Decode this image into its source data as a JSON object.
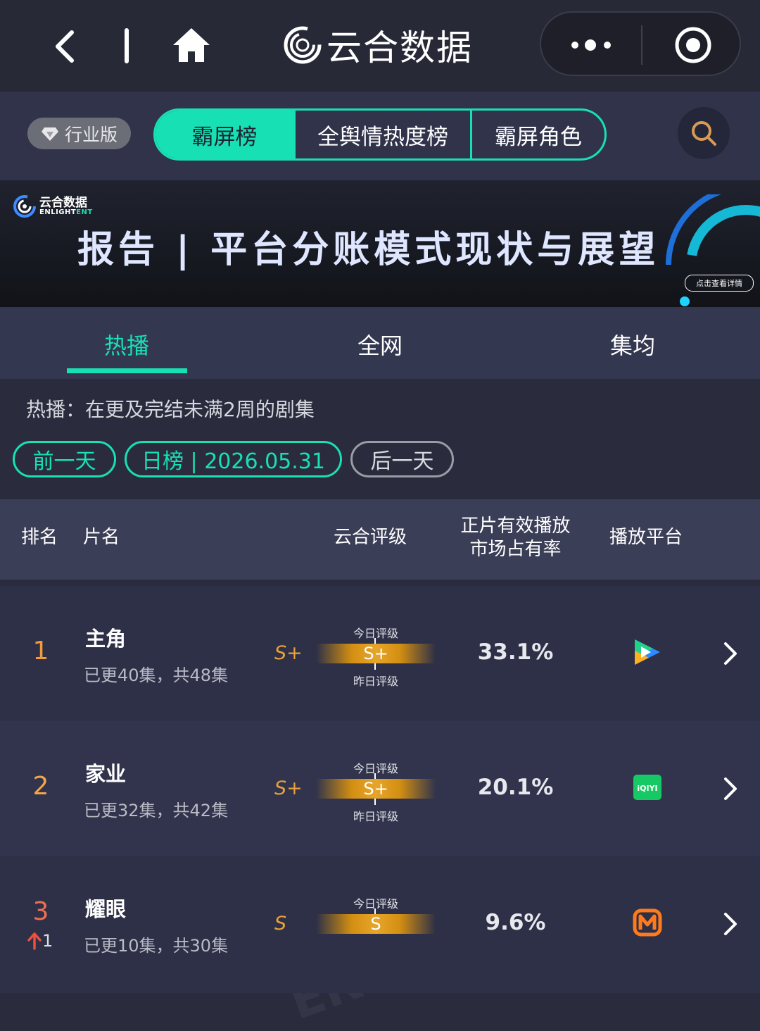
{
  "nav": {
    "brand": "云合数据"
  },
  "filters": {
    "edition": "行业版",
    "tabs": [
      "霸屏榜",
      "全舆情热度榜",
      "霸屏角色"
    ]
  },
  "banner": {
    "logo_cn": "云合数据",
    "logo_en_a": "ENLIGHT",
    "logo_en_b": "ENT",
    "title": "报告 | 平台分账模式现状与展望",
    "cta": "点击查看详情"
  },
  "subtabs": [
    "热播",
    "全网",
    "集均"
  ],
  "description": "热播：在更及完结未满2周的剧集",
  "date_nav": {
    "prev": "前一天",
    "current": "日榜 | 2026.05.31",
    "next": "后一天"
  },
  "table": {
    "headers": {
      "rank": "排名",
      "name": "片名",
      "rating": "云合评级",
      "share_line1": "正片有效播放",
      "share_line2": "市场占有率",
      "platform": "播放平台"
    },
    "rows": [
      {
        "rank": "1",
        "title": "主角",
        "episodes": "已更40集，共48集",
        "grade_left": "S+",
        "grade_bar": "S+",
        "today_label": "今日评级",
        "yesterday_label": "昨日评级",
        "share": "33.1%",
        "platform_icon": "tencent-video-icon"
      },
      {
        "rank": "2",
        "title": "家业",
        "episodes": "已更32集，共42集",
        "grade_left": "S+",
        "grade_bar": "S+",
        "today_label": "今日评级",
        "yesterday_label": "昨日评级",
        "share": "20.1%",
        "platform_icon": "iqiyi-icon",
        "platform_text": "iQIYI"
      },
      {
        "rank": "3",
        "rank_change": "1",
        "title": "耀眼",
        "episodes": "已更10集，共30集",
        "grade_left": "S",
        "grade_bar": "S",
        "today_label": "今日评级",
        "share": "9.6%",
        "platform_icon": "mango-tv-icon"
      }
    ]
  },
  "colors": {
    "accent": "#18e0b5",
    "grade": "#e8a13a"
  }
}
